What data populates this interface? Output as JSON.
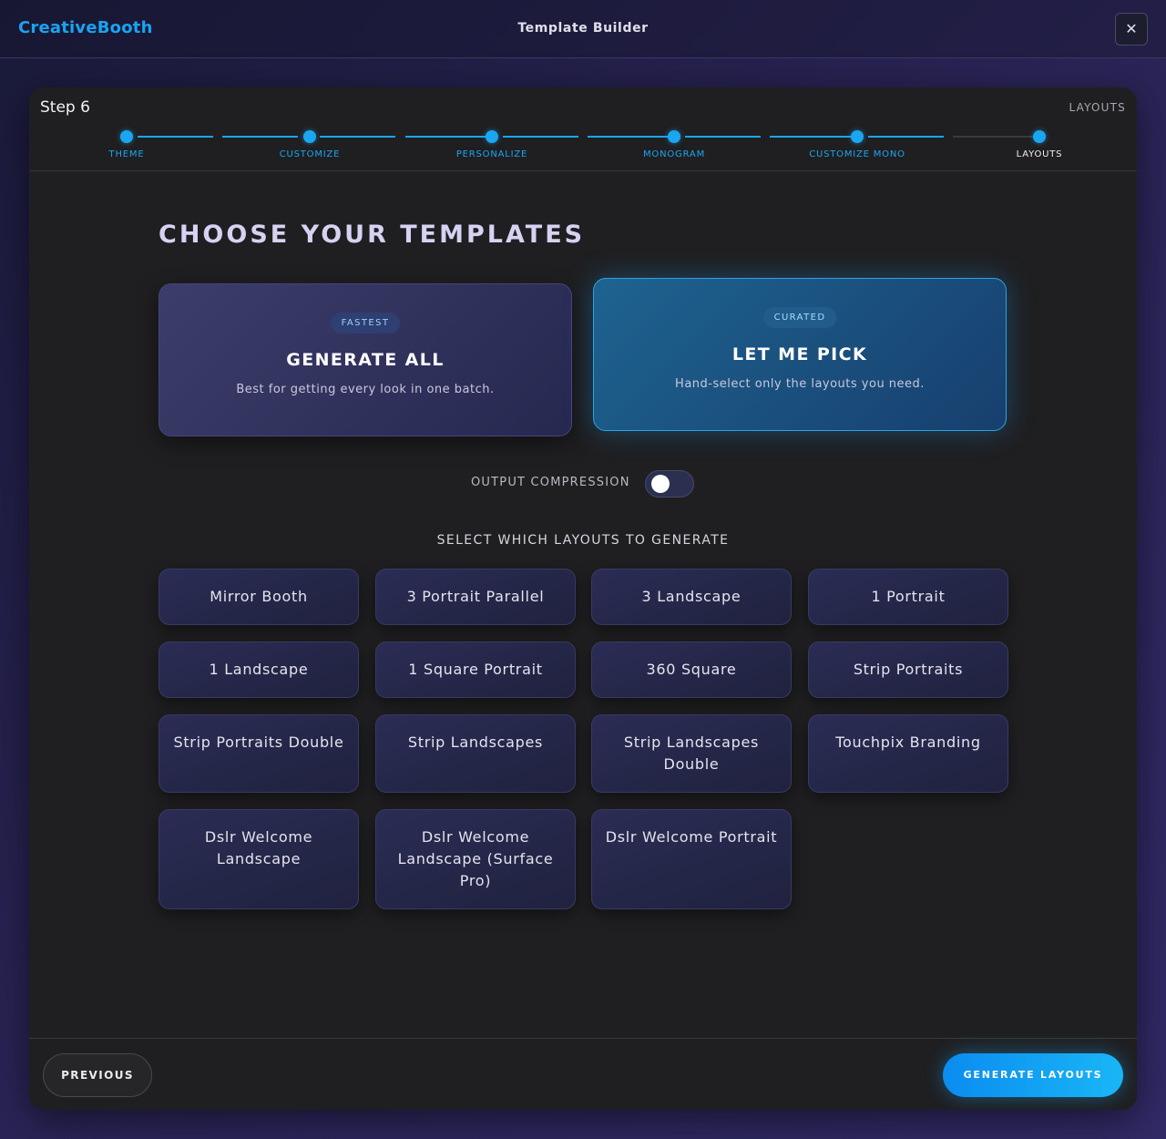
{
  "header": {
    "brand": "CreativeBooth",
    "title": "Template Builder",
    "close_icon": "close-icon"
  },
  "panel": {
    "step_label": "Step 6",
    "step_name": "LAYOUTS",
    "steps": [
      {
        "label": "THEME",
        "state": "completed"
      },
      {
        "label": "CUSTOMIZE",
        "state": "completed"
      },
      {
        "label": "PERSONALIZE",
        "state": "completed"
      },
      {
        "label": "MONOGRAM",
        "state": "completed"
      },
      {
        "label": "CUSTOMIZE MONO",
        "state": "completed"
      },
      {
        "label": "LAYOUTS",
        "state": "current"
      }
    ]
  },
  "main": {
    "heading": "CHOOSE YOUR TEMPLATES",
    "options": [
      {
        "badge": "FASTEST",
        "title": "GENERATE ALL",
        "description": "Best for getting every look in one batch.",
        "selected": false
      },
      {
        "badge": "CURATED",
        "title": "LET ME PICK",
        "description": "Hand-select only the layouts you need.",
        "selected": true
      }
    ],
    "compression": {
      "label": "OUTPUT COMPRESSION",
      "enabled": false
    },
    "layouts_heading": "SELECT WHICH LAYOUTS TO GENERATE",
    "layouts": [
      "Mirror Booth",
      "3 Portrait Parallel",
      "3 Landscape",
      "1 Portrait",
      "1 Landscape",
      "1 Square Portrait",
      "360 Square",
      "Strip Portraits",
      "Strip Portraits Double",
      "Strip Landscapes",
      "Strip Landscapes Double",
      "Touchpix Branding",
      "Dslr Welcome Landscape",
      "Dslr Welcome Landscape (Surface Pro)",
      "Dslr Welcome Portrait"
    ]
  },
  "footer": {
    "previous_label": "PREVIOUS",
    "generate_label": "GENERATE LAYOUTS"
  },
  "colors": {
    "accent": "#1aa6f0",
    "brand": "#19a3f0",
    "panel_bg": "#1f1f21",
    "heading": "#d6d2f2"
  }
}
